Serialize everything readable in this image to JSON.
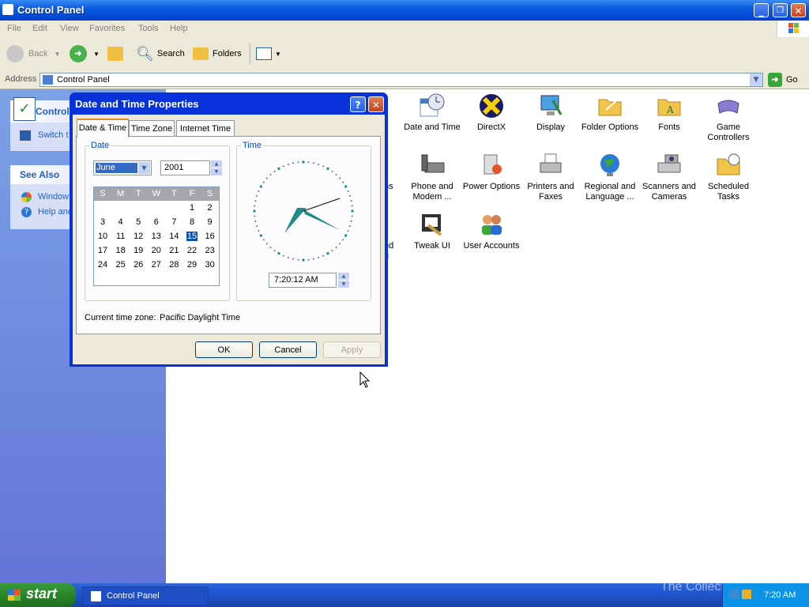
{
  "window": {
    "title": "Control Panel",
    "min": "_",
    "max": "❐",
    "close": "✕"
  },
  "menu": [
    "File",
    "Edit",
    "View",
    "Favorites",
    "Tools",
    "Help"
  ],
  "toolbar": {
    "back": "Back",
    "search": "Search",
    "folders": "Folders"
  },
  "address": {
    "label": "Address",
    "value": "Control Panel",
    "go": "Go"
  },
  "leftpanel": {
    "title": "Control",
    "switch": "Switch t",
    "see_also": "See Also",
    "links": [
      "Window",
      "Help and"
    ]
  },
  "items": [
    {
      "label": "ive",
      "row": 0
    },
    {
      "label": "Date and Time"
    },
    {
      "label": "DirectX"
    },
    {
      "label": "Display"
    },
    {
      "label": "Folder Options"
    },
    {
      "label": "Fonts"
    },
    {
      "label": "Game Controllers"
    },
    {
      "label": "ns"
    },
    {
      "label": "Phone and Modem ..."
    },
    {
      "label": "Power Options"
    },
    {
      "label": "Printers and Faxes"
    },
    {
      "label": "Regional and Language ..."
    },
    {
      "label": "Scanners and Cameras"
    },
    {
      "label": "Scheduled Tasks"
    },
    {
      "label": "nd u"
    },
    {
      "label": "Tweak UI"
    },
    {
      "label": "User Accounts"
    }
  ],
  "dialog": {
    "title": "Date and Time Properties",
    "help": "?",
    "close": "✕",
    "tabs": [
      "Date & Time",
      "Time Zone",
      "Internet Time"
    ],
    "date_group": "Date",
    "time_group": "Time",
    "month": "June",
    "year": "2001",
    "weekdays": [
      "S",
      "M",
      "T",
      "W",
      "T",
      "F",
      "S"
    ],
    "weeks": [
      [
        "",
        "",
        "",
        "",
        "",
        "1",
        "2"
      ],
      [
        "3",
        "4",
        "5",
        "6",
        "7",
        "8",
        "9"
      ],
      [
        "10",
        "11",
        "12",
        "13",
        "14",
        "15",
        "16"
      ],
      [
        "17",
        "18",
        "19",
        "20",
        "21",
        "22",
        "23"
      ],
      [
        "24",
        "25",
        "26",
        "27",
        "28",
        "29",
        "30"
      ]
    ],
    "selected_day": "15",
    "time": "7:20:12 AM",
    "timezone_label": "Current time zone:",
    "timezone": "Pacific Daylight Time",
    "ok": "OK",
    "cancel": "Cancel",
    "apply": "Apply"
  },
  "taskbar": {
    "start": "start",
    "item": "Control Panel",
    "clock": "7:20 AM",
    "watermark": "The Collection Book"
  },
  "colors": {
    "xp_blue": "#0831d9",
    "title_blue": "#0a5ce0",
    "left_panel": "#7ba2e7",
    "start_green": "#2b8a2b",
    "selected_day_bg": "#0b4fba",
    "clock_hands": "#1e8a8a"
  }
}
